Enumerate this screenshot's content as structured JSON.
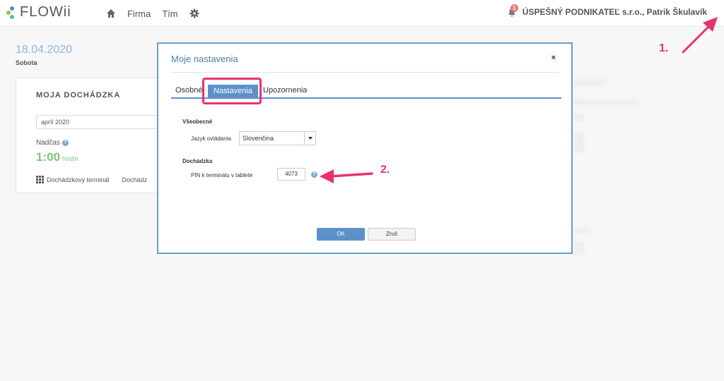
{
  "header": {
    "brand": "FLOWii",
    "nav": {
      "home_icon": "home-icon",
      "firma": "Firma",
      "tim": "Tím",
      "settings_icon": "gear-icon"
    },
    "notification_count": "1",
    "user": "ÚSPEŠNÝ PODNIKATEĽ s.r.o., Patrik Škulavík"
  },
  "page": {
    "date": "18.04.2020",
    "day": "Sobota",
    "card": {
      "title": "MOJA DOCHÁDZKA",
      "month": "apríl 2020",
      "overtime_label": "Nadčas",
      "hours_value": "1:00",
      "hours_unit": "hodín",
      "terminal_link": "Dochádzkový terminál",
      "attendance_link": "Dochádz"
    }
  },
  "dialog": {
    "title": "Moje nastavenia",
    "close": "×",
    "tabs": [
      "Osobné",
      "Nastavenia",
      "Upozornenia"
    ],
    "active_tab": "Nastavenia",
    "general": {
      "title": "Všeobecné",
      "language_label": "Jazyk ovládania",
      "language_value": "Slovenčina"
    },
    "attendance": {
      "title": "Dochádzka",
      "pin_label": "PIN k terminálu v tablete",
      "pin_value": "4073"
    },
    "ok": "OK",
    "cancel": "Zruš"
  },
  "annotations": {
    "one": "1.",
    "two": "2.",
    "color": "#e8326f"
  },
  "colors": {
    "accent": "#5c91c8",
    "hours_green": "#79c77a",
    "date_blue": "#8bb8e0"
  }
}
